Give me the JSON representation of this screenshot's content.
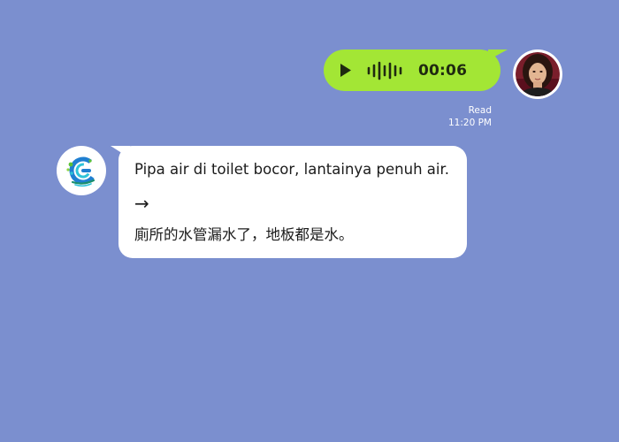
{
  "outgoing_message": {
    "type": "voice",
    "play_icon": "play-icon",
    "waveform_icon": "waveform-icon",
    "duration": "00:06",
    "bubble_color": "#a3e635",
    "status": "Read",
    "time": "11:20 PM",
    "avatar": "user-avatar"
  },
  "incoming_message": {
    "avatar": "translator-bot-logo",
    "original_text": "Pipa air di toilet bocor, lantainya penuh air.",
    "arrow": "→",
    "translated_text": "廁所的水管漏水了，地板都是水。"
  },
  "colors": {
    "background": "#7b8fcf",
    "incoming_bubble": "#ffffff"
  }
}
